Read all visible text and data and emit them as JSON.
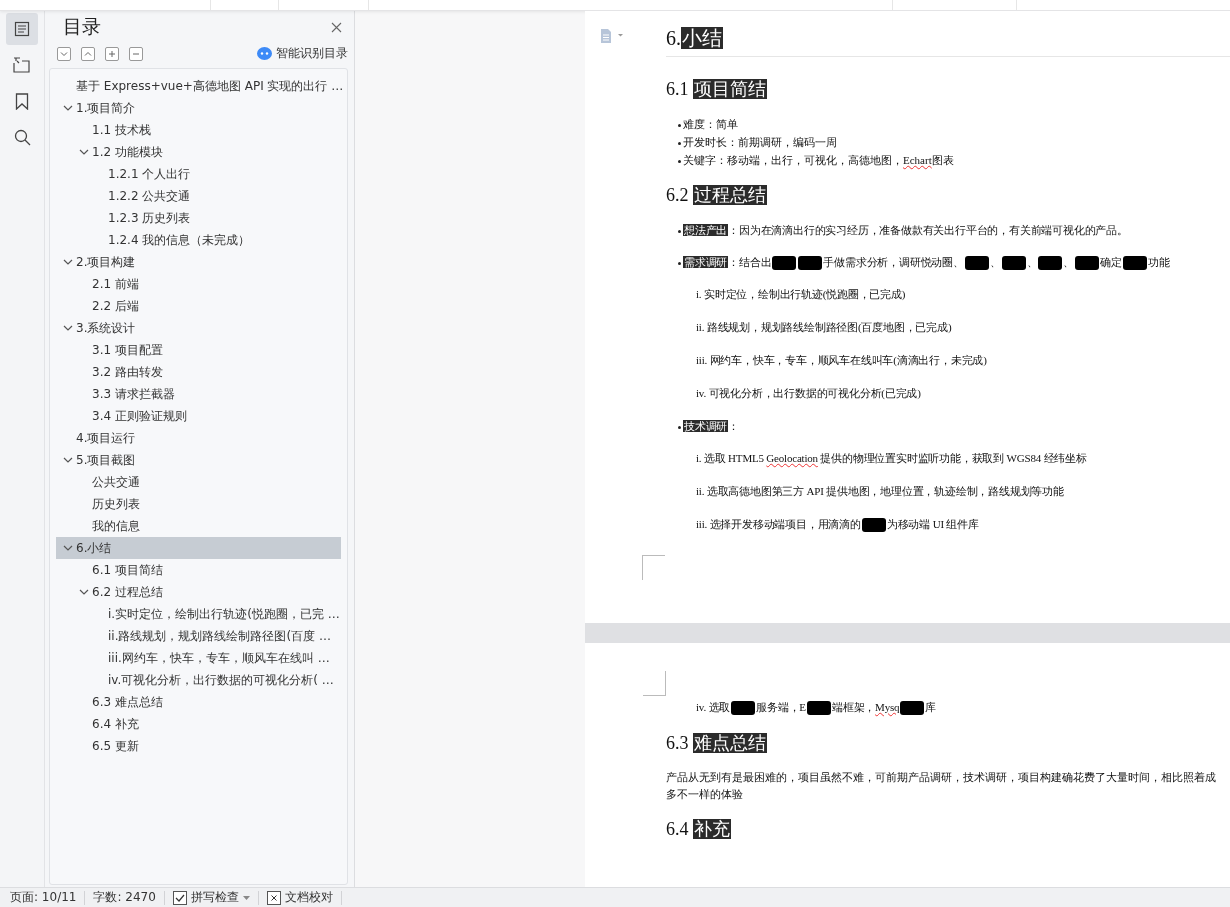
{
  "rail": [
    {
      "kind": "toc",
      "selected": true
    },
    {
      "kind": "outline",
      "selected": false
    },
    {
      "kind": "bookmark",
      "selected": false
    },
    {
      "kind": "search",
      "selected": false
    }
  ],
  "toc": {
    "title": "目录",
    "smart_button": "智能识别目录",
    "tools": [
      {
        "kind": "collapse"
      },
      {
        "kind": "expand"
      },
      {
        "kind": "plus"
      },
      {
        "kind": "minus"
      }
    ],
    "items": [
      {
        "text": "基于 Express+vue+高德地图 API 实现的出行 …",
        "selected": false
      },
      {
        "text": "1.项目简介",
        "selected": false,
        "expanded": true,
        "children": [
          {
            "text": "1.1 技术栈",
            "selected": false
          },
          {
            "text": "1.2 功能模块",
            "selected": false,
            "expanded": true,
            "children": [
              {
                "text": "1.2.1 个人出行",
                "selected": false
              },
              {
                "text": "1.2.2 公共交通",
                "selected": false
              },
              {
                "text": "1.2.3 历史列表",
                "selected": false
              },
              {
                "text": "1.2.4 我的信息（未完成）",
                "selected": false
              }
            ]
          }
        ]
      },
      {
        "text": "2.项目构建",
        "selected": false,
        "expanded": true,
        "children": [
          {
            "text": "2.1 前端",
            "selected": false
          },
          {
            "text": "2.2 后端",
            "selected": false
          }
        ]
      },
      {
        "text": "3.系统设计",
        "selected": false,
        "expanded": true,
        "children": [
          {
            "text": "3.1 项目配置",
            "selected": false
          },
          {
            "text": "3.2 路由转发",
            "selected": false
          },
          {
            "text": "3.3 请求拦截器",
            "selected": false
          },
          {
            "text": "3.4 正则验证规则",
            "selected": false
          }
        ]
      },
      {
        "text": "4.项目运行",
        "selected": false
      },
      {
        "text": "5.项目截图",
        "selected": false,
        "expanded": true,
        "children": [
          {
            "text": "公共交通",
            "selected": false
          },
          {
            "text": "历史列表",
            "selected": false
          },
          {
            "text": "我的信息",
            "selected": false
          }
        ]
      },
      {
        "text": "6.小结",
        "selected": true,
        "expanded": true,
        "children": [
          {
            "text": "6.1 项目简结",
            "selected": false
          },
          {
            "text": "6.2 过程总结",
            "selected": false,
            "expanded": true,
            "children": [
              {
                "text": "i.实时定位，绘制出行轨迹(悦跑圈，已完 …",
                "selected": false
              },
              {
                "text": "ii.路线规划，规划路线绘制路径图(百度 …",
                "selected": false
              },
              {
                "text": "iii.网约车，快车，专车，顺风车在线叫 …",
                "selected": false
              },
              {
                "text": "iv.可视化分析，出行数据的可视化分析( …",
                "selected": false
              }
            ]
          },
          {
            "text": "6.3 难点总结",
            "selected": false
          },
          {
            "text": "6.4 补充",
            "selected": false
          },
          {
            "text": "6.5 更新",
            "selected": false
          }
        ]
      }
    ]
  },
  "pages": [
    {
      "blocks": [
        {
          "kind": "h1",
          "number": "6.",
          "title": "小结"
        },
        {
          "kind": "h2",
          "number": "6.1",
          "title": "项目简结"
        },
        {
          "kind": "bullets",
          "items": [
            [
              {
                "kind": "text",
                "text": "难度：简单"
              }
            ],
            [
              {
                "kind": "text",
                "text": "开发时长：前期调研，编码一周"
              }
            ],
            [
              {
                "kind": "text",
                "text": "关键字：移动端，出行，可视化，高德地图，"
              },
              {
                "kind": "misspelled",
                "text": "Echart"
              },
              {
                "kind": "text",
                "text": "图表"
              }
            ]
          ]
        },
        {
          "kind": "h2",
          "number": "6.2",
          "title": "过程总结"
        },
        {
          "kind": "bullet",
          "segments": [
            {
              "kind": "highlight",
              "text": "想法产出"
            },
            {
              "kind": "text",
              "text": "：因为在滴滴出行的实习经历，准备做款有关出行平台的，有关前端可视化的产品。"
            }
          ]
        },
        {
          "kind": "bullet",
          "segments": [
            {
              "kind": "highlight",
              "text": "需求调研"
            },
            {
              "kind": "text",
              "text": "：结合出"
            },
            {
              "kind": "redacted"
            },
            {
              "kind": "redacted"
            },
            {
              "kind": "text",
              "text": "手做需求分析，调研悦动圈、"
            },
            {
              "kind": "redacted"
            },
            {
              "kind": "text",
              "text": "、"
            },
            {
              "kind": "redacted"
            },
            {
              "kind": "text",
              "text": "、"
            },
            {
              "kind": "redacted"
            },
            {
              "kind": "text",
              "text": "、"
            },
            {
              "kind": "redacted"
            },
            {
              "kind": "text",
              "text": "确定"
            },
            {
              "kind": "redacted"
            },
            {
              "kind": "text",
              "text": "功能"
            }
          ]
        },
        {
          "kind": "roman",
          "marker": "i.",
          "segments": [
            {
              "kind": "text",
              "text": "实时定位，绘制出行轨迹(悦跑圈，已完成)"
            }
          ]
        },
        {
          "kind": "roman",
          "marker": "ii.",
          "segments": [
            {
              "kind": "text",
              "text": "路线规划，规划路线绘制路径图(百度地图，已完成)"
            }
          ]
        },
        {
          "kind": "roman",
          "marker": "iii.",
          "segments": [
            {
              "kind": "text",
              "text": "网约车，快车，专车，顺风车在线叫车(滴滴出行，未完成)"
            }
          ]
        },
        {
          "kind": "roman",
          "marker": "iv.",
          "segments": [
            {
              "kind": "text",
              "text": "可视化分析，出行数据的可视化分析(已完成)"
            }
          ]
        },
        {
          "kind": "bullet",
          "segments": [
            {
              "kind": "highlight",
              "text": "技术调研"
            },
            {
              "kind": "text",
              "text": "："
            }
          ]
        },
        {
          "kind": "roman",
          "marker": "i.",
          "segments": [
            {
              "kind": "text",
              "text": "选取 HTML5 "
            },
            {
              "kind": "misspelled",
              "text": "Geolocation"
            },
            {
              "kind": "text",
              "text": " 提供的物理位置实时监听功能，获取到 WGS84 经纬坐标"
            }
          ]
        },
        {
          "kind": "roman",
          "marker": "ii.",
          "segments": [
            {
              "kind": "text",
              "text": "选取高德地图第三方 API 提供地图，地理位置，轨迹绘制，路线规划等功能"
            }
          ]
        },
        {
          "kind": "roman",
          "marker": "iii.",
          "segments": [
            {
              "kind": "text",
              "text": "选择开发移动端项目，用滴滴的"
            },
            {
              "kind": "redacted"
            },
            {
              "kind": "text",
              "text": "为移动端 UI 组件库"
            }
          ]
        },
        {
          "kind": "crop_mark_bottom"
        }
      ]
    },
    {
      "blocks": [
        {
          "kind": "crop_mark_top"
        },
        {
          "kind": "roman",
          "marker": "iv.",
          "segments": [
            {
              "kind": "text",
              "text": "选取"
            },
            {
              "kind": "redacted"
            },
            {
              "kind": "text",
              "text": "服务端，E"
            },
            {
              "kind": "redacted"
            },
            {
              "kind": "text",
              "text": "端框架，"
            },
            {
              "kind": "misspelled",
              "text": "Mysq"
            },
            {
              "kind": "redacted"
            },
            {
              "kind": "text",
              "text": "库"
            }
          ]
        },
        {
          "kind": "h2",
          "number": "6.3",
          "title": "难点总结"
        },
        {
          "kind": "paragraph",
          "lines": [
            "产品从无到有是最困难的，项目虽然不难，可前期产品调研，技术调研，项目构建确花费了大量时间，相比照着成",
            "多不一样的体验"
          ]
        },
        {
          "kind": "h2",
          "number": "6.4",
          "title": "补充"
        }
      ]
    }
  ],
  "status_bar": {
    "page": "页面: 10/11",
    "words": "字数: 2470",
    "spellcheck": {
      "label": "拼写检查",
      "checked": true
    },
    "proofread": "文档校对"
  }
}
